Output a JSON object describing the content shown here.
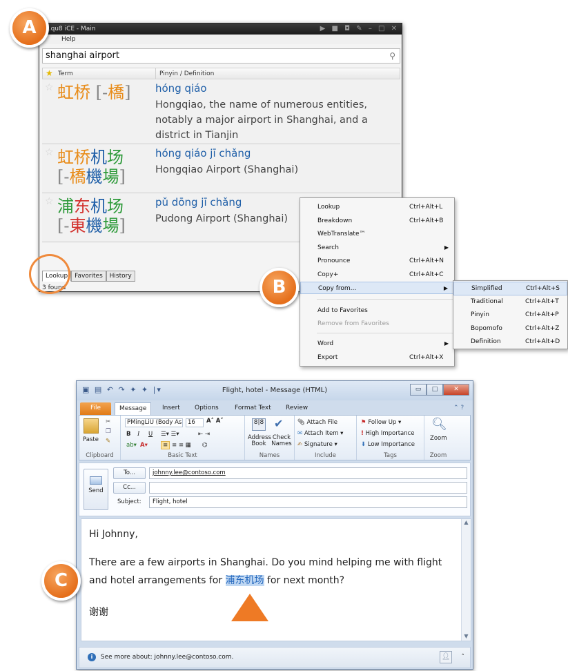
{
  "dict_window": {
    "title": "...qu8 iCE - Main",
    "menu_help": "Help",
    "search_value": "shanghai airport",
    "col_term": "Term",
    "col_pinyin": "Pinyin / Definition",
    "results": [
      {
        "pinyin": "hóng qiáo",
        "definition": "Hongqiao, the name of numerous entities, notably a major airport in Shanghai, and a district in Tianjin"
      },
      {
        "pinyin": "hóng qiáo jī chǎng",
        "definition": "Hongqiao Airport (Shanghai)"
      },
      {
        "pinyin": "pǔ dōng jī chǎng",
        "definition": "Pudong Airport (Shanghai)"
      }
    ],
    "tabs": [
      "Lookup",
      "Favorites",
      "History"
    ],
    "status": "3 found"
  },
  "context_menu": {
    "items": [
      {
        "label": "Lookup",
        "shortcut": "Ctrl+Alt+L"
      },
      {
        "label": "Breakdown",
        "shortcut": "Ctrl+Alt+B"
      },
      {
        "label": "WebTranslate™",
        "shortcut": ""
      },
      {
        "label": "Search",
        "shortcut": ""
      },
      {
        "label": "Pronounce",
        "shortcut": "Ctrl+Alt+N"
      },
      {
        "label": "Copy+",
        "shortcut": "Ctrl+Alt+C"
      },
      {
        "label": "Copy from...",
        "shortcut": ""
      },
      {
        "label": "Add to Favorites",
        "shortcut": ""
      },
      {
        "label": "Remove from Favorites",
        "shortcut": ""
      },
      {
        "label": "Word",
        "shortcut": ""
      },
      {
        "label": "Export",
        "shortcut": "Ctrl+Alt+X"
      }
    ],
    "submenu": [
      {
        "label": "Simplified",
        "shortcut": "Ctrl+Alt+S"
      },
      {
        "label": "Traditional",
        "shortcut": "Ctrl+Alt+T"
      },
      {
        "label": "Pinyin",
        "shortcut": "Ctrl+Alt+P"
      },
      {
        "label": "Bopomofo",
        "shortcut": "Ctrl+Alt+Z"
      },
      {
        "label": "Definition",
        "shortcut": "Ctrl+Alt+D"
      }
    ]
  },
  "callouts": {
    "a": "A",
    "b": "B",
    "c": "C"
  },
  "outlook": {
    "title": "Flight, hotel - Message (HTML)",
    "tabs": [
      "File",
      "Message",
      "Insert",
      "Options",
      "Format Text",
      "Review"
    ],
    "ribbon": {
      "paste": "Paste",
      "clipboard": "Clipboard",
      "font_name": "PMingLiU (Body As",
      "font_size": "16",
      "basic_text": "Basic Text",
      "address_book": "Address Book",
      "check_names": "Check Names",
      "names": "Names",
      "attach_file": "Attach File",
      "attach_item": "Attach Item",
      "signature": "Signature",
      "include": "Include",
      "follow_up": "Follow Up",
      "high_importance": "High Importance",
      "low_importance": "Low Importance",
      "tags": "Tags",
      "zoom": "Zoom",
      "zoom_group": "Zoom"
    },
    "send": "Send",
    "to_button": "To...",
    "cc_button": "Cc...",
    "subject_label": "Subject:",
    "to_value": "johnny.lee@contoso.com",
    "cc_value": "",
    "subject_value": "Flight, hotel",
    "body_greeting": "Hi Johnny,",
    "body_line1": "There are a few airports in Shanghai. Do you mind helping me with flight",
    "body_line2_pre": "and hotel arrangements for ",
    "body_highlight": "浦东机场",
    "body_line2_post": " for next month?",
    "body_signoff": "谢谢",
    "people_pane": "See more about: johnny.lee@contoso.com."
  },
  "colors": {
    "accent_orange": "#e8781f",
    "pinyin_blue": "#1f5fa8",
    "tone_orange": "#e88c1a",
    "tone_green": "#2e9a3a",
    "tone_red": "#d2302c"
  }
}
